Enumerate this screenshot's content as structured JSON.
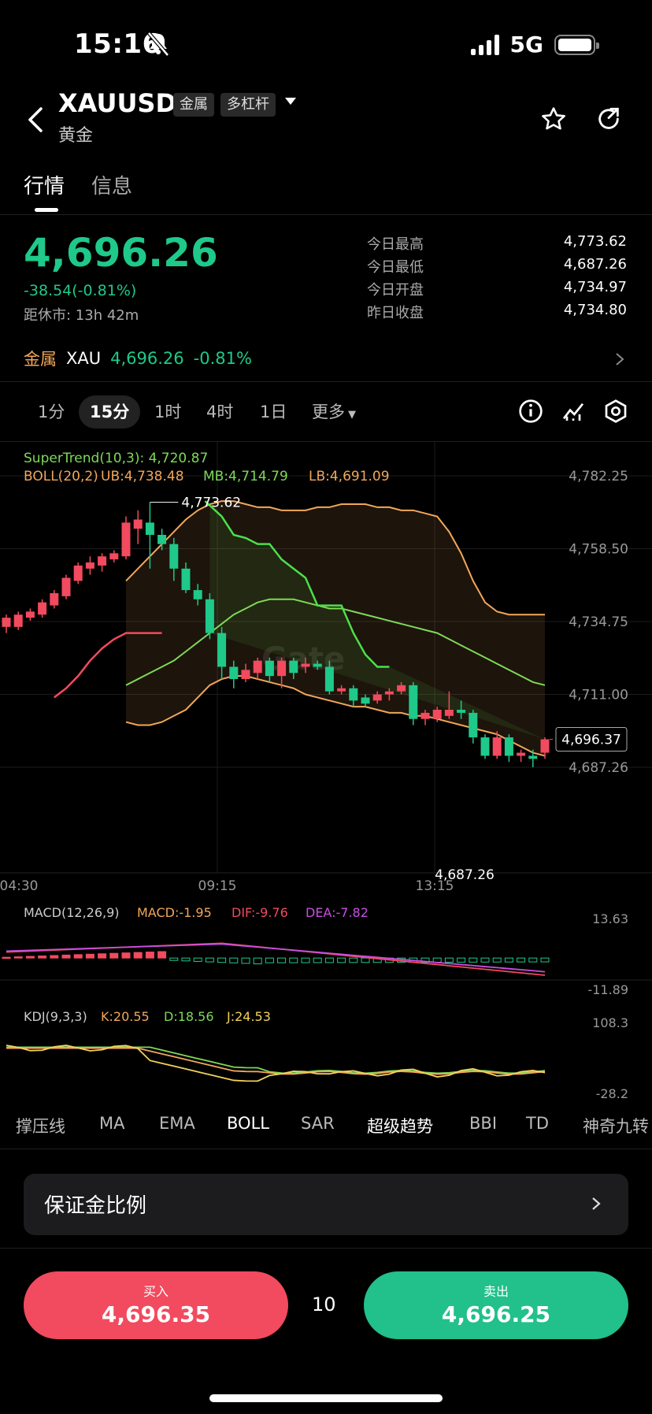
{
  "status_bar": {
    "time": "15:16",
    "network": "5G"
  },
  "header": {
    "symbol": "XAUUSD",
    "tags": [
      "金属",
      "多杠杆"
    ],
    "name": "黄金",
    "tabs": [
      "行情",
      "信息"
    ]
  },
  "quote": {
    "price": "4,696.26",
    "change": "-38.54(-0.81%)",
    "close_countdown": "距休市: 13h 42m",
    "stats": [
      {
        "label": "今日最高",
        "value": "4,773.62"
      },
      {
        "label": "今日最低",
        "value": "4,687.26"
      },
      {
        "label": "今日开盘",
        "value": "4,734.97"
      },
      {
        "label": "昨日收盘",
        "value": "4,734.80"
      }
    ]
  },
  "metal_row": {
    "category": "金属",
    "symbol": "XAU",
    "price": "4,696.26",
    "change": "-0.81%"
  },
  "timeframes": [
    "1分",
    "15分",
    "1时",
    "4时",
    "1日",
    "更多"
  ],
  "active_timeframe": "15分",
  "indicators": {
    "supertrend": "SuperTrend(10,3): 4,720.87",
    "boll": "BOLL(20,2)",
    "boll_ub": "UB:4,738.48",
    "boll_mb": "MB:4,714.79",
    "boll_lb": "LB:4,691.09",
    "macd_name": "MACD(12,26,9)",
    "macd": "MACD:-1.95",
    "dif": "DIF:-9.76",
    "dea": "DEA:-7.82",
    "kdj_name": "KDJ(9,3,3)",
    "k": "K:20.55",
    "d": "D:18.56",
    "j": "J:24.53"
  },
  "chart_data": {
    "type": "candlestick",
    "y_ticks": [
      "4,782.25",
      "4,758.50",
      "4,734.75",
      "4,711.00",
      "4,687.26"
    ],
    "ylim": [
      4687.26,
      4782.25
    ],
    "x_ticks": [
      "04:30",
      "09:15",
      "13:15"
    ],
    "high_label": "4,773.62",
    "low_label": "4,687.26",
    "current_label": "4,696.37",
    "watermark": "Gate",
    "candles": [
      [
        4733,
        4736,
        4731,
        4737
      ],
      [
        4733,
        4737,
        4732,
        4738
      ],
      [
        4736,
        4738,
        4735,
        4739
      ],
      [
        4737,
        4741,
        4736,
        4742
      ],
      [
        4740,
        4744,
        4739,
        4745
      ],
      [
        4743,
        4749,
        4742,
        4750
      ],
      [
        4748,
        4753,
        4747,
        4754
      ],
      [
        4752,
        4754,
        4750,
        4756
      ],
      [
        4753,
        4756,
        4751,
        4757
      ],
      [
        4755,
        4757,
        4754,
        4758
      ],
      [
        4756,
        4767,
        4755,
        4769
      ],
      [
        4765,
        4768,
        4760,
        4771
      ],
      [
        4767,
        4763,
        4752,
        4773.62
      ],
      [
        4763,
        4760,
        4758,
        4765
      ],
      [
        4760,
        4752,
        4748,
        4762
      ],
      [
        4752,
        4745,
        4744,
        4754
      ],
      [
        4745,
        4742,
        4740,
        4747
      ],
      [
        4742,
        4731,
        4729,
        4744
      ],
      [
        4731,
        4720,
        4716,
        4733
      ],
      [
        4720,
        4716,
        4713,
        4722
      ],
      [
        4716,
        4719,
        4715,
        4721
      ],
      [
        4718,
        4722,
        4716,
        4723
      ],
      [
        4722,
        4717,
        4715,
        4723
      ],
      [
        4717,
        4722,
        4713,
        4723
      ],
      [
        4722,
        4718,
        4716,
        4723
      ],
      [
        4720,
        4721,
        4718,
        4723
      ],
      [
        4721,
        4720,
        4719,
        4722
      ],
      [
        4720,
        4712,
        4711,
        4722
      ],
      [
        4712,
        4713,
        4711,
        4714
      ],
      [
        4713,
        4709,
        4707,
        4714
      ],
      [
        4710,
        4708,
        4707,
        4711
      ],
      [
        4709,
        4711,
        4708,
        4712
      ],
      [
        4711,
        4712,
        4709,
        4713
      ],
      [
        4712,
        4714,
        4711,
        4715
      ],
      [
        4714,
        4703,
        4701,
        4715
      ],
      [
        4703,
        4705,
        4701,
        4706
      ],
      [
        4703,
        4706,
        4702,
        4707
      ],
      [
        4704,
        4706,
        4703,
        4712
      ],
      [
        4706,
        4705,
        4703,
        4709
      ],
      [
        4705,
        4697,
        4695,
        4706
      ],
      [
        4697,
        4691,
        4690,
        4698
      ],
      [
        4691,
        4697,
        4690,
        4699
      ],
      [
        4697,
        4691,
        4689,
        4698
      ],
      [
        4691,
        4692,
        4689,
        4693
      ],
      [
        4691,
        4690,
        4687.26,
        4693
      ],
      [
        4692,
        4696.37,
        4690,
        4697
      ]
    ],
    "boll_ub": [
      4748,
      4752,
      4756,
      4760,
      4764,
      4768,
      4771,
      4773,
      4774,
      4774,
      4773,
      4772,
      4772,
      4771,
      4771,
      4771,
      4772,
      4772,
      4773,
      4773,
      4773,
      4772,
      4772,
      4771,
      4771,
      4770,
      4769,
      4764,
      4757,
      4748,
      4741,
      4738,
      4737,
      4737,
      4737,
      4737
    ],
    "boll_mb": [
      4714,
      4716,
      4718,
      4720,
      4722,
      4725,
      4728,
      4731,
      4734,
      4737,
      4739,
      4741,
      4742,
      4742,
      4742,
      4741,
      4740,
      4739,
      4739,
      4738,
      4737,
      4736,
      4735,
      4734,
      4733,
      4732,
      4731,
      4729,
      4727,
      4725,
      4723,
      4721,
      4719,
      4717,
      4715,
      4714
    ],
    "boll_lb": [
      4702,
      4701,
      4701,
      4702,
      4704,
      4706,
      4710,
      4714,
      4716,
      4717,
      4717,
      4716,
      4715,
      4714,
      4713,
      4711,
      4710,
      4709,
      4708,
      4707,
      4707,
      4706,
      4705,
      4705,
      4704,
      4704,
      4703,
      4702,
      4701,
      4700,
      4699,
      4698,
      4696,
      4694,
      4692,
      4691
    ],
    "supertrend_up": [
      4710,
      4713,
      4717,
      4722,
      4726,
      4729,
      4731,
      4731,
      4731,
      4731
    ],
    "supertrend_down": [
      4774,
      4769,
      4763,
      4762,
      4760,
      4760,
      4755,
      4752,
      4749,
      4740,
      4740,
      4740,
      4731,
      4724,
      4720,
      4720
    ],
    "macd_ylim": [
      -11.89,
      13.63
    ],
    "macd_y_ticks": [
      "13.63",
      "-11.89"
    ],
    "kdj_ylim": [
      -28.2,
      108.3
    ],
    "kdj_y_ticks": [
      "108.3",
      "-28.2"
    ]
  },
  "indicator_tabs": [
    "撑压线",
    "MA",
    "EMA",
    "BOLL",
    "SAR",
    "超级趋势",
    "BBI",
    "TD",
    "神奇九转"
  ],
  "active_indicator_tabs": [
    "BOLL",
    "超级趋势"
  ],
  "margin": {
    "label": "保证金比例"
  },
  "trade": {
    "buy_label": "买入",
    "buy_price": "4,696.35",
    "quantity": "10",
    "sell_label": "卖出",
    "sell_price": "4,696.25"
  },
  "colors": {
    "up": "#1ec98a",
    "down": "#f24a5e",
    "boll": "#f2a65a",
    "mb": "#7ed957",
    "supertrend": "#4be04b"
  }
}
